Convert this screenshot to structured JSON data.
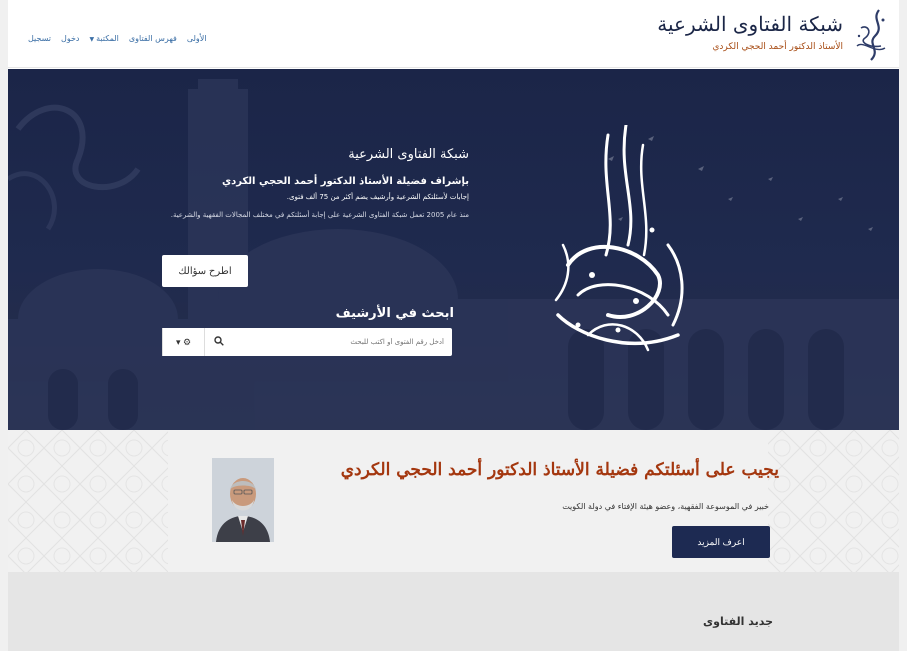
{
  "header": {
    "brand_title": "شبكة الفتاوى الشرعية",
    "brand_subtitle": "الأستاذ الدكتور أحمد الحجي الكردي",
    "nav": [
      {
        "label": "الأولى",
        "has_caret": false
      },
      {
        "label": "فهرس الفتاوى",
        "has_caret": false
      },
      {
        "label": "المكتبة",
        "has_caret": true
      },
      {
        "label": "دخول",
        "has_caret": false
      },
      {
        "label": "تسجيل",
        "has_caret": false
      }
    ]
  },
  "hero": {
    "title": "شبكة الفتاوى الشرعية",
    "lead": "بإشراف فضيلة الأستاذ الدكتور أحمد الحجي الكردي",
    "line": "إجابات لأسئلتكم الشرعية وأرشيف يضم أكثر من 75 ألف فتوى.",
    "description": "منذ عام 2005 تعمل شبكة الفتاوى الشرعية على إجابة أسئلتكم في مختلف المجالات الفقهية والشرعية.",
    "ask_button": "اطرح سؤالك",
    "search_title": "ابحث في الأرشيف",
    "search_placeholder": "أدخل رقم الفتوى أو اكتب للبحث",
    "search_icon": "search-icon",
    "options_icon": "cogs-icon"
  },
  "scholar": {
    "title": "يجيب على أسئلتكم فضيلة الأستاذ الدكتور أحمد الحجي الكردي",
    "subtitle": "خبير في الموسوعة الفقهية، وعضو هيئة الإفتاء في دولة الكويت",
    "more_button": "اعرف المزيد"
  },
  "latest": {
    "title": "جديد الفتاوى"
  },
  "colors": {
    "navy": "#1b2548",
    "accent": "#a4370f",
    "link": "#3a6ea5"
  }
}
